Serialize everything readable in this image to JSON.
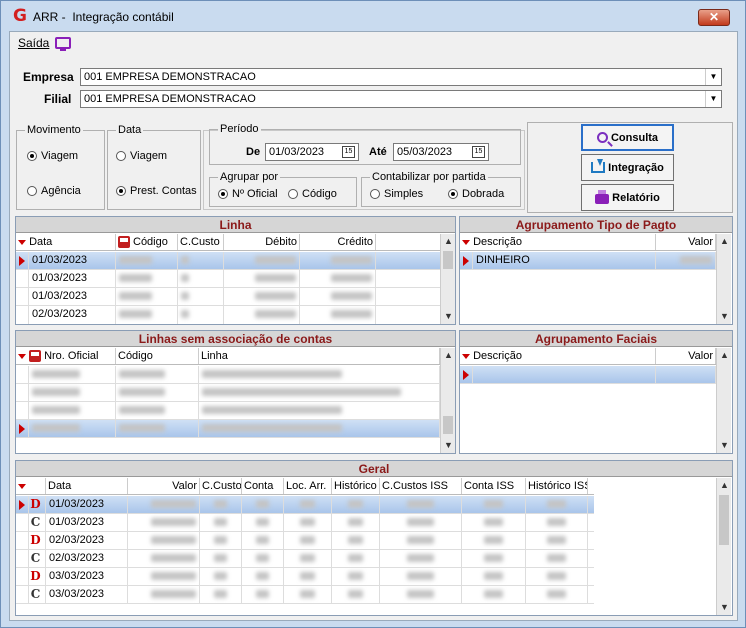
{
  "window": {
    "title": "ARR -  Integração contábil",
    "close_label": "✕"
  },
  "menu": {
    "saida": "Saída"
  },
  "header": {
    "empresa_label": "Empresa",
    "empresa_value": "001 EMPRESA DEMONSTRACAO",
    "filial_label": "Filial",
    "filial_value": "001 EMPRESA DEMONSTRACAO"
  },
  "filters": {
    "movimento": {
      "caption": "Movimento",
      "options": [
        "Viagem",
        "Agência"
      ],
      "selected": "Viagem"
    },
    "data": {
      "caption": "Data",
      "options": [
        "Viagem",
        "Prest. Contas"
      ],
      "selected": "Prest. Contas"
    },
    "periodo": {
      "caption": "Período",
      "de_label": "De",
      "de_value": "01/03/2023",
      "ate_label": "Até",
      "ate_value": "05/03/2023",
      "cal_glyph": "15"
    },
    "agrupar": {
      "caption": "Agrupar por",
      "options": [
        "Nº Oficial",
        "Código"
      ],
      "selected": "Nº Oficial"
    },
    "contabilizar": {
      "caption": "Contabilizar por partida",
      "options": [
        "Simples",
        "Dobrada"
      ],
      "selected": "Dobrada"
    }
  },
  "actions": {
    "consulta": "Consulta",
    "integracao": "Integração",
    "relatorio": "Relatório"
  },
  "linha": {
    "title": "Linha",
    "columns": [
      "Data",
      "Código",
      "C.Custo",
      "Débito",
      "Crédito"
    ],
    "rows": [
      "01/03/2023",
      "01/03/2023",
      "01/03/2023",
      "02/03/2023"
    ]
  },
  "agrup_pagto": {
    "title": "Agrupamento Tipo de Pagto",
    "columns": [
      "Descrição",
      "Valor"
    ],
    "rows": [
      "DINHEIRO"
    ]
  },
  "linhas_sem": {
    "title": "Linhas sem associação de contas",
    "columns": [
      "Nro. Oficial",
      "Código",
      "Linha"
    ]
  },
  "agrup_faciais": {
    "title": "Agrupamento Faciais",
    "columns": [
      "Descrição",
      "Valor"
    ]
  },
  "geral": {
    "title": "Geral",
    "columns": [
      "Data",
      "Valor",
      "C.Custo",
      "Conta",
      "Loc. Arr.",
      "Histórico",
      "C.Custos ISS",
      "Conta ISS",
      "Histórico ISS"
    ],
    "rows": [
      {
        "dc": "D",
        "date": "01/03/2023"
      },
      {
        "dc": "C",
        "date": "01/03/2023"
      },
      {
        "dc": "D",
        "date": "02/03/2023"
      },
      {
        "dc": "C",
        "date": "02/03/2023"
      },
      {
        "dc": "D",
        "date": "03/03/2023"
      },
      {
        "dc": "C",
        "date": "03/03/2023"
      }
    ]
  }
}
